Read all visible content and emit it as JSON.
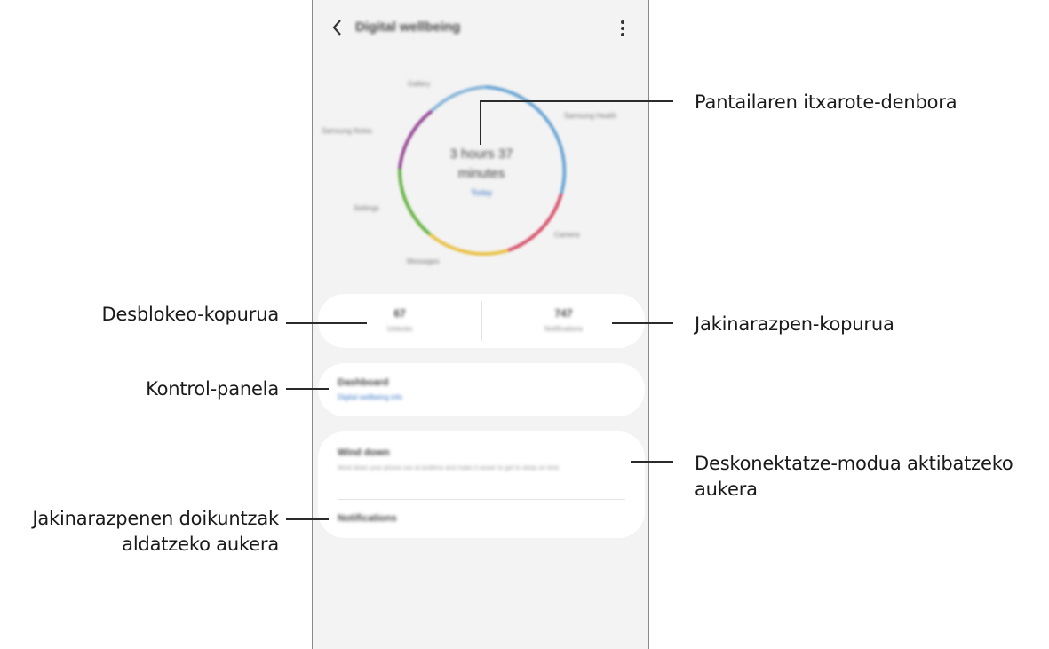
{
  "app": {
    "title": "Digital wellbeing",
    "back_icon": "back-arrow-icon",
    "more_icon": "more-vertical-icon"
  },
  "ring": {
    "center_value": "3 hours 37 minutes",
    "center_sub": "Today",
    "labels": [
      "Gallery",
      "Samsung Notes",
      "Samsung Health",
      "Settings",
      "Messages",
      "Camera"
    ],
    "segment_colors": [
      "#8bb8d9",
      "#6fa8d6",
      "#d9566e",
      "#e9c24a",
      "#6cb649",
      "#9a4f9a"
    ]
  },
  "stats": {
    "unlocks_value": "67",
    "unlocks_label": "Unlocks",
    "notifications_value": "747",
    "notifications_label": "Notifications"
  },
  "dashboard": {
    "title": "Dashboard",
    "subtitle": "Digital wellbeing info"
  },
  "wind_down": {
    "title": "Wind down",
    "description": "Wind down your phone use at bedtime and make it easier to get to sleep on time",
    "notifications_label": "Notifications"
  },
  "callouts": {
    "screen_time": "Pantailaren itxarote-denbora",
    "unlocks": "Desblokeo-kopurua",
    "notifications_count": "Jakinarazpen-kopurua",
    "dashboard": "Kontrol-panela",
    "wind_down_line1": "Deskonektatze-modua aktibatzeko",
    "wind_down_line2": "aukera",
    "notif_settings_line1": "Jakinarazpenen doikuntzak",
    "notif_settings_line2": "aldatzeko aukera"
  }
}
